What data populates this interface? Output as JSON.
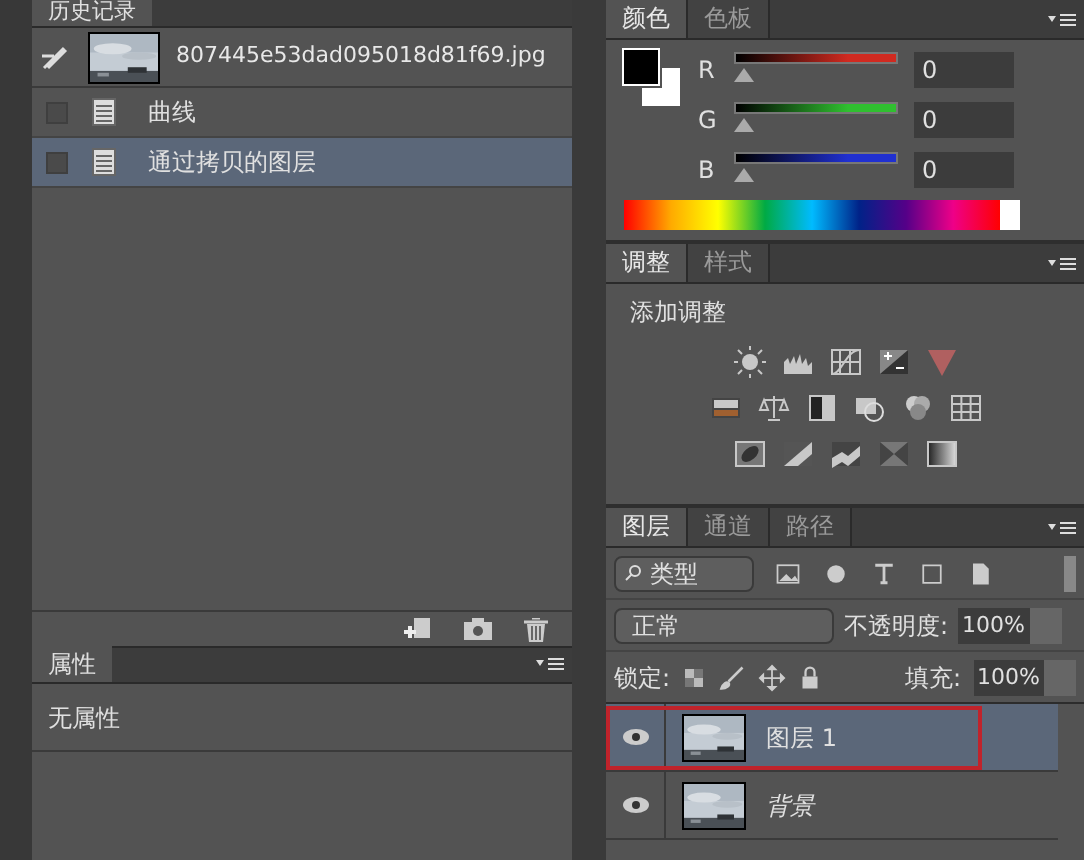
{
  "history": {
    "tab": "历史记录",
    "snapshot": "807445e53dad095018d81f69.jpg",
    "steps": [
      {
        "label": "曲线",
        "selected": false
      },
      {
        "label": "通过拷贝的图层",
        "selected": true
      }
    ]
  },
  "properties": {
    "tab": "属性",
    "message": "无属性"
  },
  "color": {
    "tabs": [
      {
        "label": "颜色",
        "selected": true
      },
      {
        "label": "色板",
        "selected": false
      }
    ],
    "channels": [
      {
        "label": "R",
        "value": "0",
        "color": "#d02a20",
        "level": 0
      },
      {
        "label": "G",
        "value": "0",
        "color": "#30c030",
        "level": 0
      },
      {
        "label": "B",
        "value": "0",
        "color": "#2030d0",
        "level": 0
      }
    ]
  },
  "adjustments": {
    "tabs": [
      {
        "label": "调整",
        "selected": true
      },
      {
        "label": "样式",
        "selected": false
      }
    ],
    "heading": "添加调整"
  },
  "layers_panel": {
    "tabs": [
      {
        "label": "图层",
        "selected": true
      },
      {
        "label": "通道",
        "selected": false
      },
      {
        "label": "路径",
        "selected": false
      }
    ],
    "filter": "类型",
    "blend_mode": "正常",
    "opacity_label": "不透明度:",
    "opacity": "100%",
    "lock_label": "锁定:",
    "fill_label": "填充:",
    "fill": "100%",
    "layers": [
      {
        "name": "图层 1",
        "kind": "layer",
        "selected": true,
        "visible": true,
        "highlighted": true
      },
      {
        "name": "背景",
        "kind": "background",
        "selected": false,
        "visible": true,
        "highlighted": false
      }
    ]
  }
}
